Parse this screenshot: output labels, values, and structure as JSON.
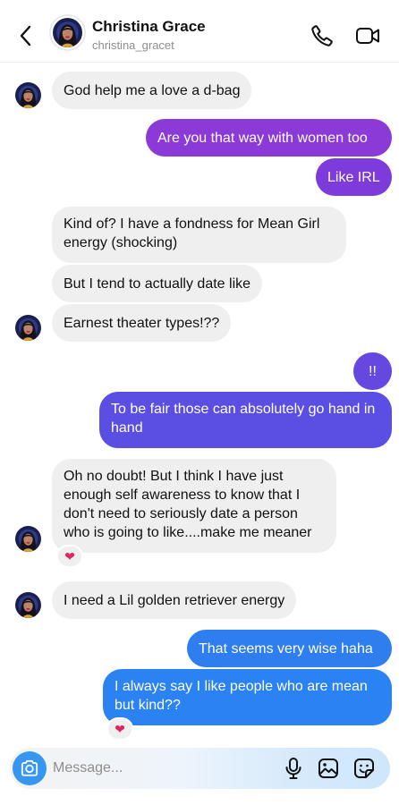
{
  "header": {
    "name": "Christina Grace",
    "handle": "christina_gracet",
    "icons": [
      "back-chevron-icon",
      "phone-icon",
      "video-camera-icon"
    ]
  },
  "messages": [
    {
      "from": "them",
      "text": "God help me a love a d-bag"
    },
    {
      "from": "me",
      "text": "Are you that way with women too"
    },
    {
      "from": "me",
      "text": "Like IRL"
    },
    {
      "from": "them",
      "text": "Kind of? I have a fondness for Mean Girl energy (shocking)"
    },
    {
      "from": "them",
      "text": "But I tend to actually date like"
    },
    {
      "from": "them",
      "text": "Earnest theater types!??"
    },
    {
      "from": "me",
      "text": "!!"
    },
    {
      "from": "me",
      "text": "To be fair those can absolutely go hand in hand"
    },
    {
      "from": "them",
      "text": "Oh no doubt! But I think I have just enough self awareness to know that I don't need to seriously date a person who is going to like....make me meaner",
      "reaction": "❤"
    },
    {
      "from": "them",
      "text": "I need a Lil golden retriever energy"
    },
    {
      "from": "me",
      "text": "That seems very wise haha"
    },
    {
      "from": "me",
      "text": "I always say I like people who are mean but kind??",
      "reaction": "❤"
    }
  ],
  "composer": {
    "placeholder": "Message...",
    "icons": [
      "camera-icon",
      "microphone-icon",
      "gallery-icon",
      "sticker-icon"
    ]
  },
  "colors": {
    "incoming_bubble": "#efefef",
    "outgoing_purple": "#8a3ad6",
    "outgoing_indigo": "#5b4fe0",
    "outgoing_blue": "#2e7df0",
    "camera_button": "#3797f0",
    "reaction_heart": "#e0245e"
  }
}
